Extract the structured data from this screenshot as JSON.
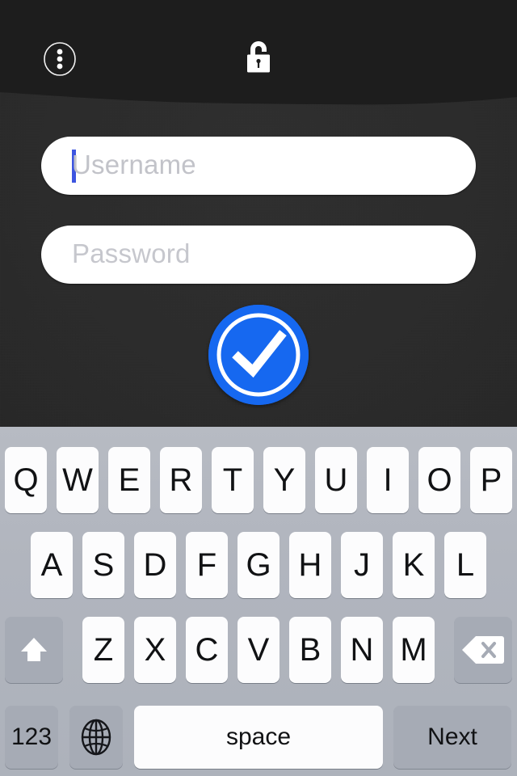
{
  "app": {
    "background_color": "#2a2a2a",
    "topbar_color": "#1d1d1d"
  },
  "topbar": {
    "menu_icon": "overflow-menu-icon",
    "menu_label": "More options",
    "lock_icon": "unlocked-padlock-icon",
    "lock_label": "Unlocked"
  },
  "form": {
    "username": {
      "placeholder": "Username",
      "value": "",
      "focused": true,
      "caret_color": "#3d55e0"
    },
    "password": {
      "placeholder": "Password",
      "value": "",
      "focused": false
    },
    "submit": {
      "icon": "checkmark-icon",
      "label": "Submit",
      "color": "#1668f0",
      "mark_color": "#ffffff"
    }
  },
  "keyboard": {
    "background_color": "#b2b6bf",
    "key_color": "#fcfcfd",
    "modifier_key_color": "#a6abb5",
    "rows": [
      {
        "name": "row-1",
        "keys": [
          {
            "label": "Q",
            "name": "key-q",
            "type": "letter"
          },
          {
            "label": "W",
            "name": "key-w",
            "type": "letter"
          },
          {
            "label": "E",
            "name": "key-e",
            "type": "letter"
          },
          {
            "label": "R",
            "name": "key-r",
            "type": "letter"
          },
          {
            "label": "T",
            "name": "key-t",
            "type": "letter"
          },
          {
            "label": "Y",
            "name": "key-y",
            "type": "letter"
          },
          {
            "label": "U",
            "name": "key-u",
            "type": "letter"
          },
          {
            "label": "I",
            "name": "key-i",
            "type": "letter"
          },
          {
            "label": "O",
            "name": "key-o",
            "type": "letter"
          },
          {
            "label": "P",
            "name": "key-p",
            "type": "letter"
          }
        ]
      },
      {
        "name": "row-2",
        "keys": [
          {
            "label": "A",
            "name": "key-a",
            "type": "letter"
          },
          {
            "label": "S",
            "name": "key-s",
            "type": "letter"
          },
          {
            "label": "D",
            "name": "key-d",
            "type": "letter"
          },
          {
            "label": "F",
            "name": "key-f",
            "type": "letter"
          },
          {
            "label": "G",
            "name": "key-g",
            "type": "letter"
          },
          {
            "label": "H",
            "name": "key-h",
            "type": "letter"
          },
          {
            "label": "J",
            "name": "key-j",
            "type": "letter"
          },
          {
            "label": "K",
            "name": "key-k",
            "type": "letter"
          },
          {
            "label": "L",
            "name": "key-l",
            "type": "letter"
          }
        ]
      },
      {
        "name": "row-3",
        "keys": [
          {
            "label": "",
            "name": "shift-key",
            "type": "icon",
            "icon": "shift-up-arrow-icon"
          },
          {
            "label": "Z",
            "name": "key-z",
            "type": "letter"
          },
          {
            "label": "X",
            "name": "key-x",
            "type": "letter"
          },
          {
            "label": "C",
            "name": "key-c",
            "type": "letter"
          },
          {
            "label": "V",
            "name": "key-v",
            "type": "letter"
          },
          {
            "label": "B",
            "name": "key-b",
            "type": "letter"
          },
          {
            "label": "N",
            "name": "key-n",
            "type": "letter"
          },
          {
            "label": "M",
            "name": "key-m",
            "type": "letter"
          },
          {
            "label": "",
            "name": "backspace-key",
            "type": "icon",
            "icon": "backspace-delete-icon"
          }
        ]
      },
      {
        "name": "row-4",
        "keys": [
          {
            "label": "123",
            "name": "numeric-key",
            "type": "func"
          },
          {
            "label": "",
            "name": "globe-key",
            "type": "icon",
            "icon": "globe-icon"
          },
          {
            "label": "space",
            "name": "space-key",
            "type": "func"
          },
          {
            "label": "Next",
            "name": "next-key",
            "type": "func"
          }
        ]
      }
    ]
  }
}
